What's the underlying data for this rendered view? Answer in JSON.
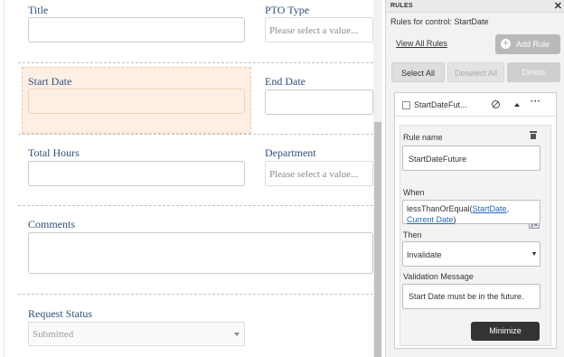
{
  "form": {
    "fields": {
      "title_label": "Title",
      "pto_type_label": "PTO Type",
      "pto_type_placeholder": "Please select a value...",
      "start_date_label": "Start Date",
      "end_date_label": "End Date",
      "total_hours_label": "Total Hours",
      "department_label": "Department",
      "department_placeholder": "Please select a value...",
      "comments_label": "Comments",
      "request_status_label": "Request Status",
      "request_status_value": "Submitted"
    }
  },
  "panel": {
    "title": "RULES",
    "close_icon": "close-icon",
    "subtitle": "Rules for control: StartDate",
    "view_all_rules": "View All Rules",
    "add_rule": "Add Rule",
    "select_all": "Select All",
    "deselect_all": "Deselect All",
    "delete": "Delete",
    "rule": {
      "short_name": "StartDateFut...",
      "rule_name_label": "Rule name",
      "rule_name_value": "StartDateFuture",
      "when_label": "When",
      "when_func": "lessThanOrEqual(",
      "when_arg1": "StartDate",
      "when_sep": ",",
      "when_arg2": "Current Date",
      "when_close": ")",
      "then_label": "Then",
      "then_value": "Invalidate",
      "validation_label": "Validation Message",
      "validation_value": "Start Date must be in the future.",
      "minimize": "Minimize"
    }
  }
}
